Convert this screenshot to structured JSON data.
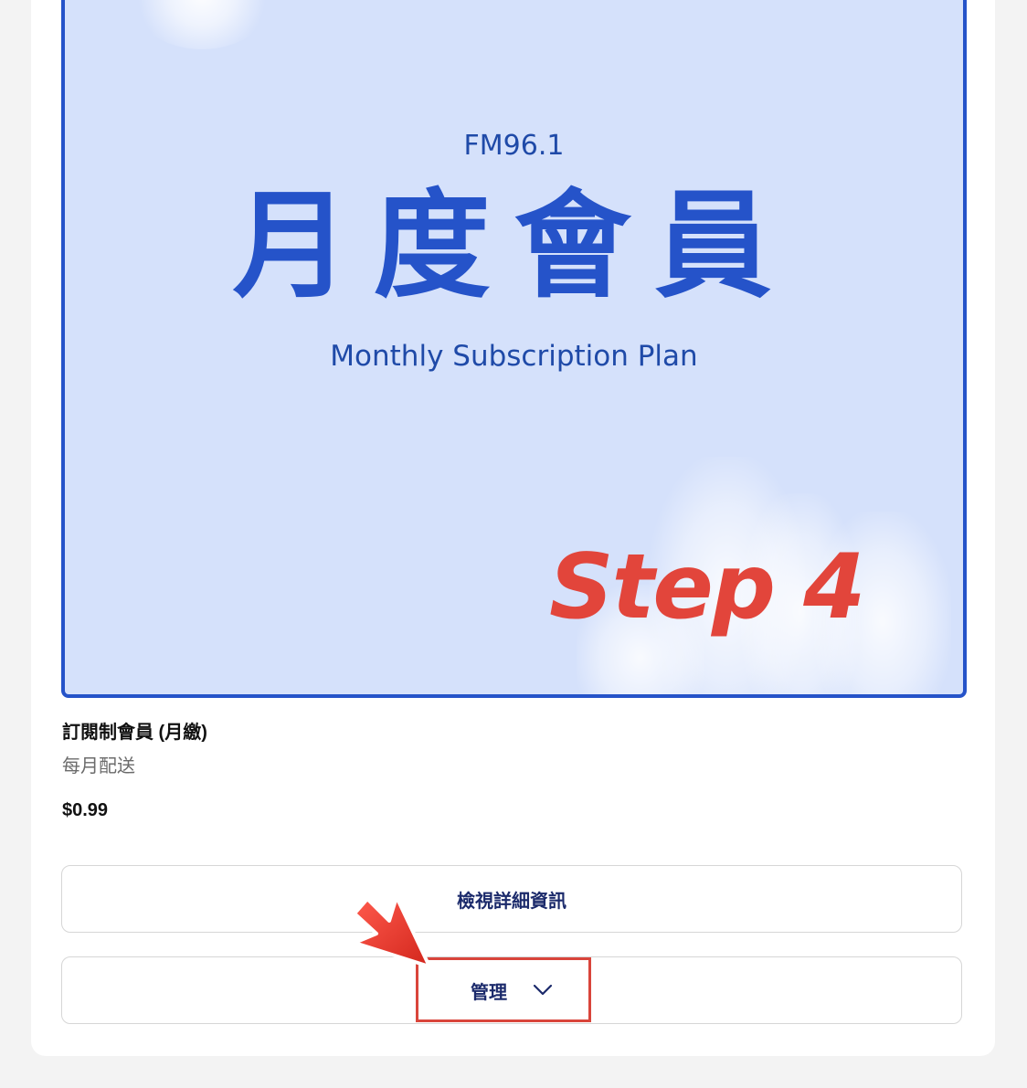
{
  "banner": {
    "station": "FM96.1",
    "title": "月度會員",
    "subtitle": "Monthly Subscription Plan",
    "step_label": "Step 4"
  },
  "plan": {
    "name": "訂閱制會員 (月繳)",
    "frequency": "每月配送",
    "price": "$0.99"
  },
  "buttons": {
    "details_label": "檢視詳細資訊",
    "manage_label": "管理"
  },
  "icons": {
    "manage_dropdown": "chevron-down-icon",
    "pointer": "pointer-arrow-icon"
  },
  "colors": {
    "banner_bg": "#d5e1fb",
    "brand_blue": "#2553c9",
    "highlight_red": "#d9453b"
  }
}
